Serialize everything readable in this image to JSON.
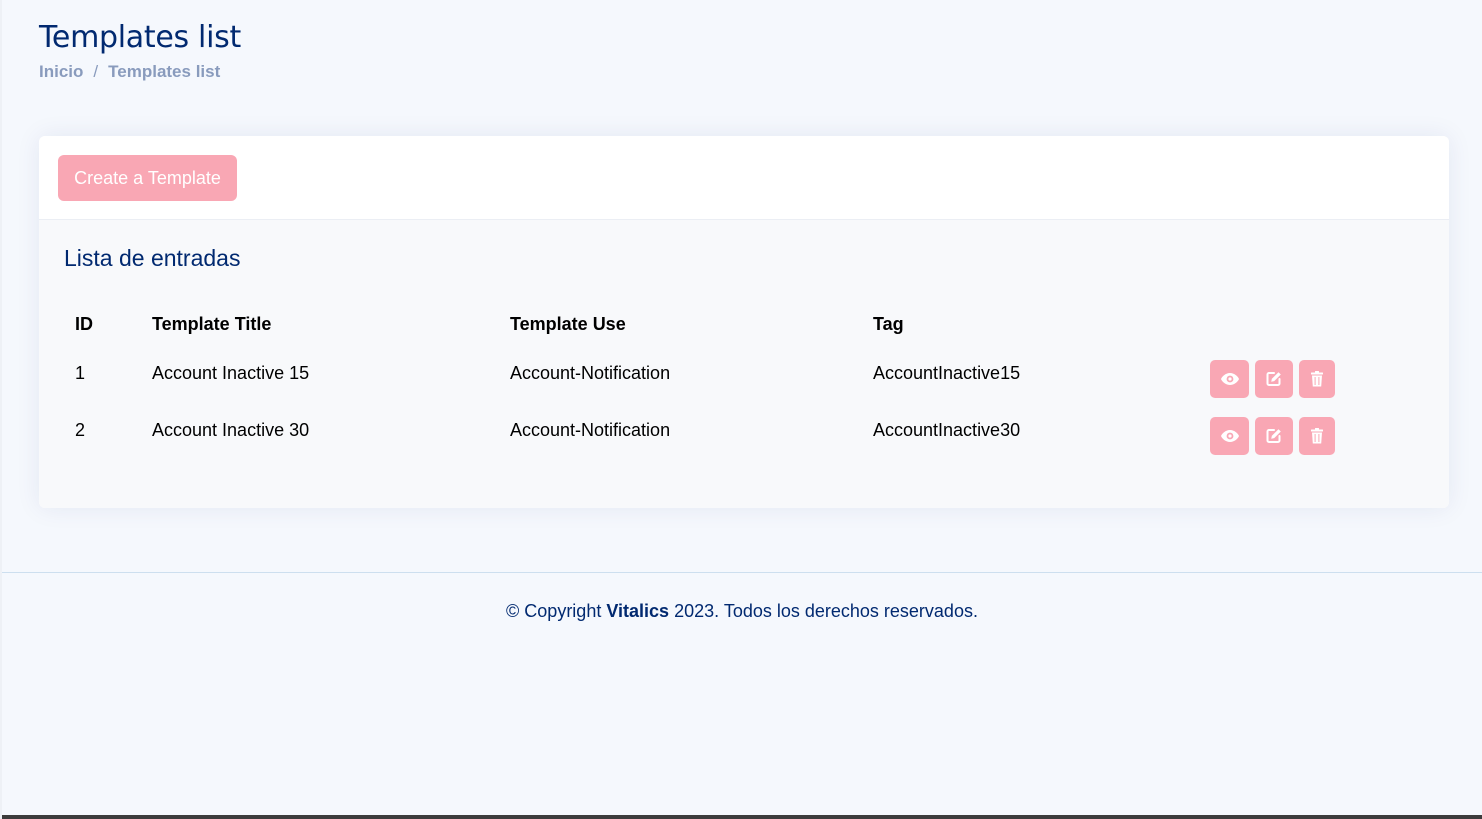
{
  "page": {
    "title": "Templates list",
    "breadcrumb": {
      "home": "Inicio",
      "separator": "/",
      "current": "Templates list"
    }
  },
  "card": {
    "create_button": "Create a Template",
    "section_title": "Lista de entradas"
  },
  "table": {
    "headers": {
      "id": "ID",
      "title": "Template Title",
      "use": "Template Use",
      "tag": "Tag"
    },
    "rows": [
      {
        "id": "1",
        "title": "Account Inactive 15",
        "use": "Account-Notification",
        "tag": "AccountInactive15"
      },
      {
        "id": "2",
        "title": "Account Inactive 30",
        "use": "Account-Notification",
        "tag": "AccountInactive30"
      }
    ],
    "row_actions": [
      "eye-icon",
      "edit-icon",
      "trash-icon"
    ]
  },
  "footer": {
    "prefix": "© Copyright",
    "brand": "Vitalics",
    "suffix": "2023. Todos los derechos reservados."
  },
  "colors": {
    "heading": "#012970",
    "breadcrumb": "#899bbd",
    "accent_button": "#f9a7b4",
    "page_background": "#f5f8fd"
  }
}
